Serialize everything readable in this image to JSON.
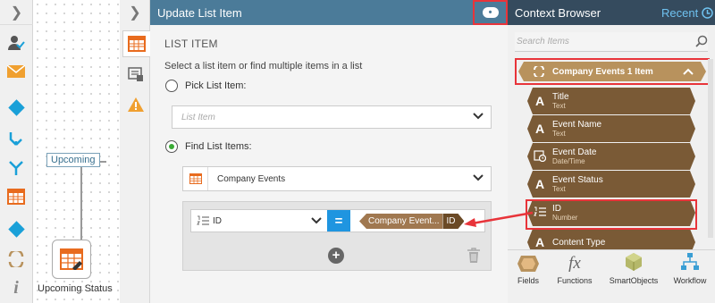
{
  "canvas": {
    "upcoming_tag": "Upcoming",
    "status_node_label": "Upcoming Status"
  },
  "left_toolbar": {
    "icons": [
      "chevron-right-icon",
      "user-task-icon",
      "email-icon",
      "diamond-icon",
      "split-icon",
      "merge-icon",
      "list-item-icon",
      "diamond-icon",
      "loop-icon",
      "info-icon"
    ]
  },
  "panel": {
    "title": "Update List Item",
    "section_title": "LIST ITEM",
    "description": "Select a list item or find multiple items in a list",
    "pick_label": "Pick List Item:",
    "list_item_placeholder": "List Item",
    "find_label": "Find List Items:",
    "list_value": "Company Events",
    "filter": {
      "field_value": "ID",
      "operator": "=",
      "reference_name": "Company Event...",
      "reference_field": "ID"
    }
  },
  "context_browser": {
    "title": "Context Browser",
    "recent_label": "Recent",
    "search_placeholder": "Search Items",
    "group_label": "Company Events 1 Item",
    "items": [
      {
        "name": "Title",
        "type": "Text",
        "icon": "A"
      },
      {
        "name": "Event Name",
        "type": "Text",
        "icon": "A"
      },
      {
        "name": "Event Date",
        "type": "Date/Time",
        "icon": "date-icon"
      },
      {
        "name": "Event Status",
        "type": "Text",
        "icon": "A"
      },
      {
        "name": "ID",
        "type": "Number",
        "icon": "number-list-icon"
      },
      {
        "name": "Content Type",
        "type": "",
        "icon": "A"
      }
    ],
    "footer": [
      {
        "label": "Fields",
        "icon": "fields-icon"
      },
      {
        "label": "Functions",
        "icon": "functions-icon"
      },
      {
        "label": "SmartObjects",
        "icon": "smartobjects-icon"
      },
      {
        "label": "Workflow",
        "icon": "workflow-icon"
      }
    ]
  },
  "colors": {
    "header_blue": "#4b7b99",
    "cb_header": "#354b5e",
    "field_brown": "#7a5a36",
    "group_tan": "#b8925d",
    "highlight_red": "#e8343a",
    "radio_green": "#3aaa35",
    "operator_blue": "#1f95e0"
  }
}
